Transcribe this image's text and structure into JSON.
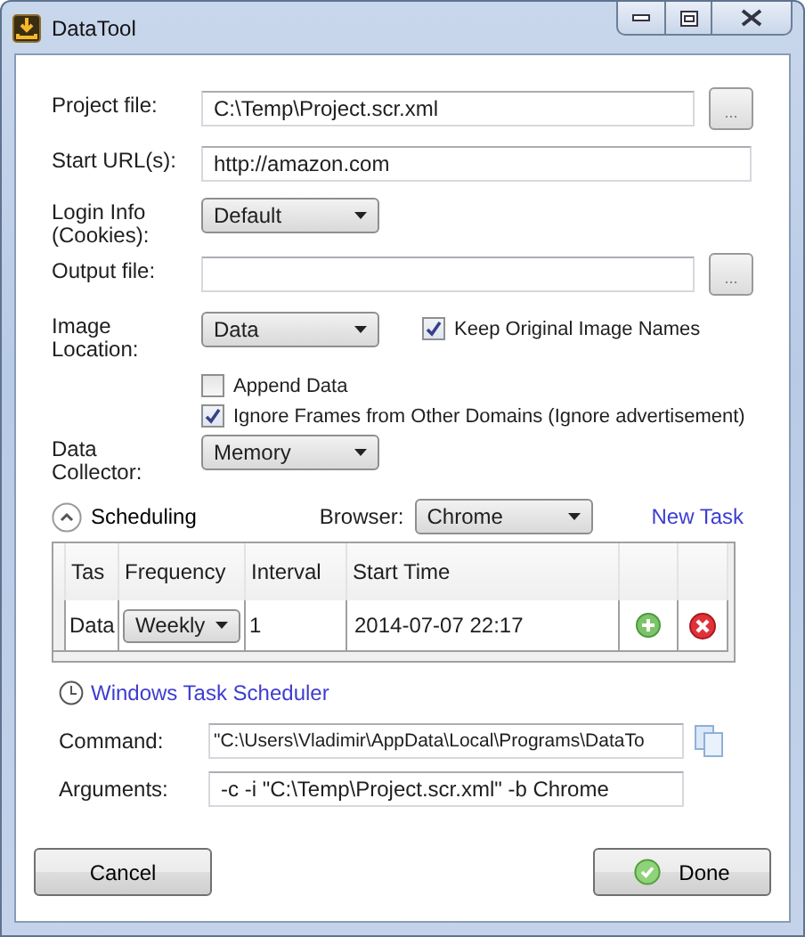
{
  "window": {
    "title": "DataTool"
  },
  "form": [
    {
      "kind": "file",
      "label": "Project file:",
      "value": "C:\\Temp\\Project.scr.xml",
      "button": "..."
    },
    {
      "kind": "text",
      "label": "Start URL(s):",
      "value": "http://amazon.com"
    },
    {
      "kind": "select",
      "label": "Login Info\n(Cookies):",
      "value": "Default"
    },
    {
      "kind": "file",
      "label": "Output file:",
      "button": "..."
    },
    {
      "kind": "select",
      "label": "Image\nLocation:",
      "value": "Data",
      "checkbox": {
        "label": "Keep Original Image Names",
        "checked": true
      }
    },
    {
      "kind": "checkbox",
      "label": "Append Data",
      "checked": false
    },
    {
      "kind": "checkbox",
      "label": "Ignore Frames from Other Domains (Ignore advertisement)",
      "checked": true
    },
    {
      "kind": "select",
      "label": "Data\nCollector:",
      "value": "Memory"
    }
  ],
  "scheduling": {
    "toggle": "Scheduling",
    "expanded": true,
    "browser_label": "Browser:",
    "browser": "Chrome",
    "new_task": "New Task"
  },
  "table": {
    "columns": [
      "Tas",
      "Frequency",
      "Interval",
      "Start Time"
    ],
    "rows": [
      {
        "task": "Data",
        "frequency": "Weekly",
        "interval": "1",
        "start_time": "2014-07-07 22:17"
      }
    ]
  },
  "scheduler_link": "Windows Task Scheduler",
  "command": {
    "label": "Command:",
    "value": "\"C:\\Users\\Vladimir\\AppData\\Local\\Programs\\DataTo"
  },
  "arguments": {
    "label": "Arguments:",
    "value": "-c -i \"C:\\Temp\\Project.scr.xml\" -b Chrome"
  },
  "buttons": [
    {
      "label": "Cancel",
      "kind": "plain"
    },
    {
      "label": "Done",
      "kind": "ok"
    }
  ]
}
